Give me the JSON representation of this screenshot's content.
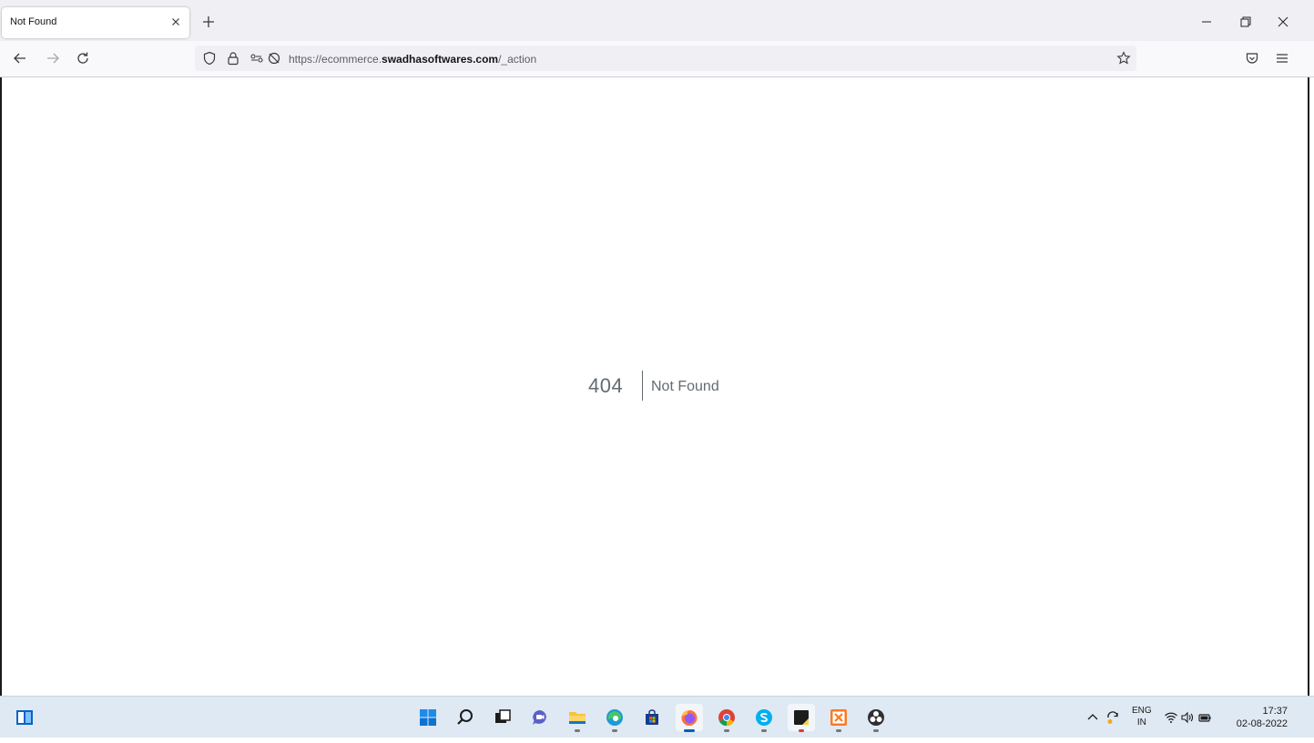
{
  "browser": {
    "tab": {
      "title": "Not Found",
      "close_label": "×"
    },
    "url": {
      "prefix": "https://ecommerce.",
      "domain": "swadhasoftwares.com",
      "path": "/_action"
    }
  },
  "page": {
    "error_code": "404",
    "error_message": "Not Found"
  },
  "taskbar": {
    "apps": [
      "start-icon",
      "search-icon",
      "task-view-icon",
      "chat-icon",
      "file-explorer-icon",
      "edge-icon",
      "store-icon",
      "firefox-icon",
      "chrome-icon",
      "skype-icon",
      "sticky-notes-icon",
      "xampp-icon",
      "obs-icon"
    ],
    "tray": {
      "lang_top": "ENG",
      "lang_bottom": "IN",
      "time": "17:37",
      "date": "02-08-2022"
    }
  },
  "colors": {
    "error_text": "#636b6f",
    "taskbar_bg": "#dfe9f3",
    "tab_bar_bg": "#f0f0f4"
  }
}
